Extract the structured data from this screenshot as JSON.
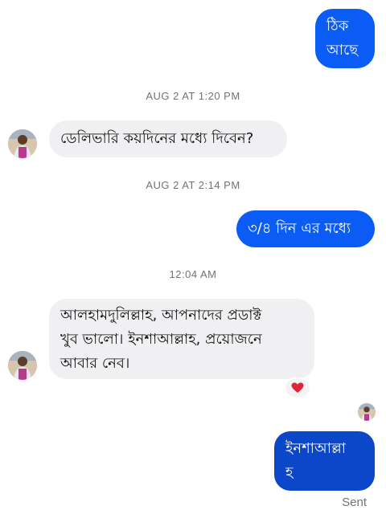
{
  "conversation": {
    "messages": [
      {
        "direction": "outgoing",
        "text": "ঠিক\nআছে"
      },
      {
        "direction": "incoming",
        "text": "ডেলিভারি কয়দিনের মধ্যে দিবেন?"
      },
      {
        "direction": "outgoing",
        "text": "৩/৪ দিন এর মধ্যে"
      },
      {
        "direction": "incoming",
        "text": "আলহামদুলিল্লাহ, আপনাদের প্রডাক্ট\nখুব ভালো। ইনশাআল্লাহ, প্রয়োজনে\nআবার নেব।",
        "reaction": "heart-icon"
      },
      {
        "direction": "outgoing",
        "text": "ইনশাআল্লা\nহ"
      }
    ],
    "timestamps": [
      "AUG 2 AT 1:20 PM",
      "AUG 2 AT 2:14 PM",
      "12:04 AM"
    ],
    "status": "Sent"
  },
  "colors": {
    "outgoing_bubble": "#0a5cf5",
    "incoming_bubble": "#f0f0f2",
    "reaction_heart": "#e0243d",
    "timestamp_text": "#6f7378"
  }
}
